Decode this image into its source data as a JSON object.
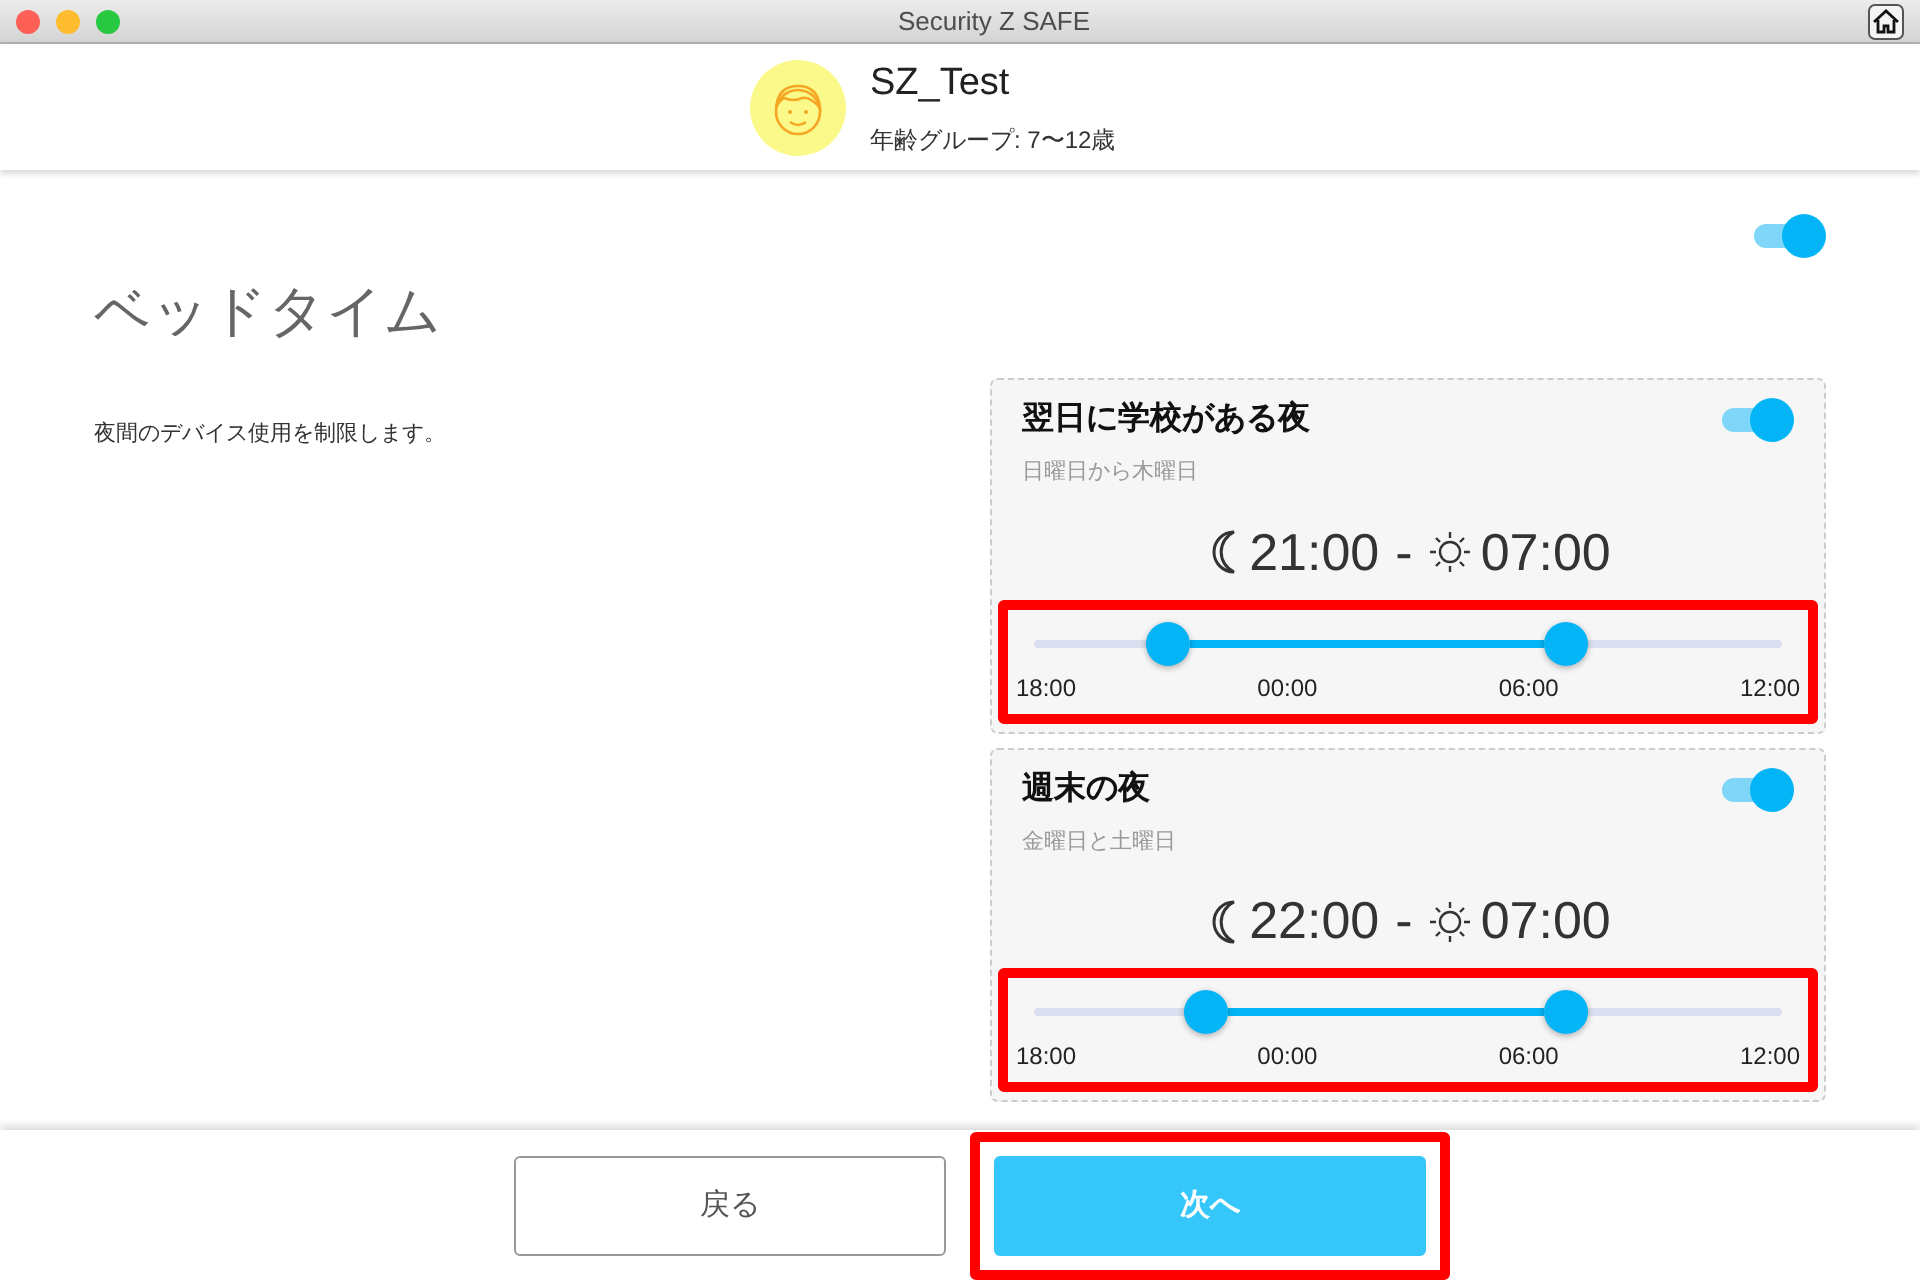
{
  "window": {
    "title": "Security Z SAFE"
  },
  "profile": {
    "name": "SZ_Test",
    "age_group": "年齢グループ: 7〜12歳"
  },
  "page": {
    "title": "ベッドタイム",
    "description": "夜間のデバイス使用を制限します。",
    "on": true
  },
  "schedules": [
    {
      "title": "翌日に学校がある夜",
      "days": "日曜日から木曜日",
      "on": true,
      "start": "21:00",
      "separator": "-",
      "end": "07:00",
      "highlighted": true,
      "thumbs": [
        {
          "level": 0.18
        },
        {
          "level": 0.71
        }
      ],
      "ticks": [
        "18:00",
        "00:00",
        "06:00",
        "12:00"
      ]
    },
    {
      "title": "週末の夜",
      "days": "金曜日と土曜日",
      "on": true,
      "start": "22:00",
      "separator": "-",
      "end": "07:00",
      "highlighted": true,
      "thumbs": [
        {
          "level": 0.23
        },
        {
          "level": 0.71
        }
      ],
      "ticks": [
        "18:00",
        "00:00",
        "06:00",
        "12:00"
      ]
    }
  ],
  "buttons": [
    {
      "label": "戻る",
      "kind": "secondary",
      "highlighted": false
    },
    {
      "label": "次へ",
      "kind": "primary",
      "highlighted": true
    }
  ]
}
